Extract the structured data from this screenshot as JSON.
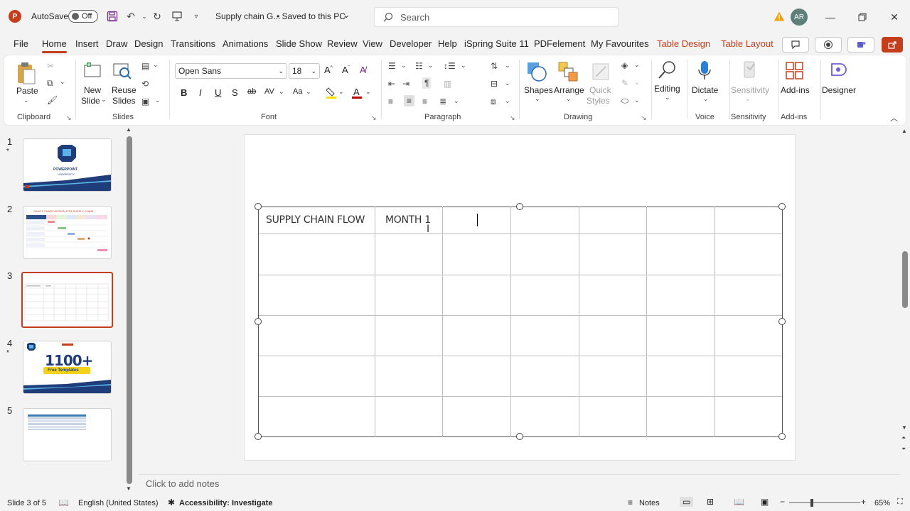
{
  "titlebar": {
    "app_icon": "P",
    "autosave_label": "AutoSave",
    "autosave_state": "Off",
    "doc_title": "Supply chain G...",
    "save_status": "• Saved to this PC",
    "search_placeholder": "Search",
    "avatar_initials": "AR"
  },
  "menu": {
    "tabs": [
      "File",
      "Home",
      "Insert",
      "Draw",
      "Design",
      "Transitions",
      "Animations",
      "Slide Show",
      "Review",
      "View",
      "Developer",
      "Help",
      "iSpring Suite 11",
      "PDFelement",
      "My Favourites",
      "Table Design",
      "Table Layout"
    ],
    "active_tab": "Home"
  },
  "ribbon": {
    "clipboard": {
      "paste": "Paste",
      "label": "Clipboard"
    },
    "slides": {
      "new_slide": "New",
      "new_slide2": "Slide",
      "reuse": "Reuse",
      "reuse2": "Slides",
      "label": "Slides"
    },
    "font": {
      "family": "Open Sans",
      "size": "18",
      "label": "Font"
    },
    "paragraph": {
      "label": "Paragraph"
    },
    "drawing": {
      "shapes": "Shapes",
      "arrange": "Arrange",
      "quick": "Quick",
      "styles": "Styles",
      "label": "Drawing"
    },
    "editing": {
      "editing": "Editing"
    },
    "voice": {
      "dictate": "Dictate",
      "label": "Voice"
    },
    "sensitivity": {
      "sensitivity": "Sensitivity",
      "label": "Sensitivity"
    },
    "addins": {
      "addins": "Add-ins",
      "label": "Add-ins"
    },
    "designer": {
      "designer": "Designer"
    }
  },
  "thumbnails": {
    "numbers": [
      "1",
      "2",
      "3",
      "4",
      "5"
    ],
    "slide1_title": "POWERPOINT",
    "slide1_sub": "UNIVERSITY",
    "slide2_title": "GANTT CHART DESIGN FOR SUPPLY CHAIN",
    "slide4_big": "1100+",
    "slide4_sub": "Free Templates"
  },
  "table": {
    "header": [
      "SUPPLY CHAIN FLOW",
      "MONTH 1",
      "",
      "",
      "",
      "",
      ""
    ]
  },
  "notes": {
    "placeholder": "Click to add notes"
  },
  "status": {
    "slide_info": "Slide 3 of 5",
    "language": "English (United States)",
    "accessibility": "Accessibility: Investigate",
    "notes": "Notes",
    "zoom": "65%"
  },
  "colors": {
    "accent": "#c43e1c",
    "table_design": "#c43e1c"
  }
}
